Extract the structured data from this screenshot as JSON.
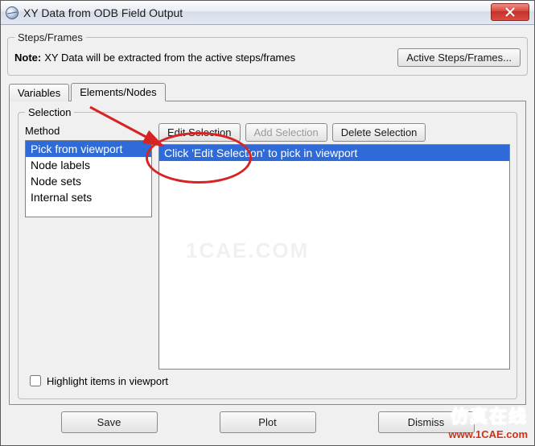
{
  "window": {
    "title": "XY Data from ODB Field Output"
  },
  "steps": {
    "legend": "Steps/Frames",
    "note_label": "Note:",
    "note_text": "XY Data will be extracted from the active steps/frames",
    "active_button": "Active Steps/Frames..."
  },
  "tabs": {
    "variables": "Variables",
    "elements_nodes": "Elements/Nodes"
  },
  "selection": {
    "legend": "Selection",
    "method_label": "Method",
    "methods": [
      "Pick from viewport",
      "Node labels",
      "Node sets",
      "Internal sets"
    ],
    "selected_method_index": 0,
    "edit_button": "Edit Selection",
    "add_button": "Add Selection",
    "delete_button": "Delete Selection",
    "pick_items": [
      "Click 'Edit Selection' to pick in viewport"
    ],
    "selected_pick_index": 0,
    "highlight_label": "Highlight items in viewport"
  },
  "bottom": {
    "save": "Save",
    "plot": "Plot",
    "dismiss": "Dismiss"
  },
  "watermarks": {
    "center": "1CAE.COM",
    "corner_cn": "仿真在线",
    "corner_url": "www.1CAE.com"
  }
}
